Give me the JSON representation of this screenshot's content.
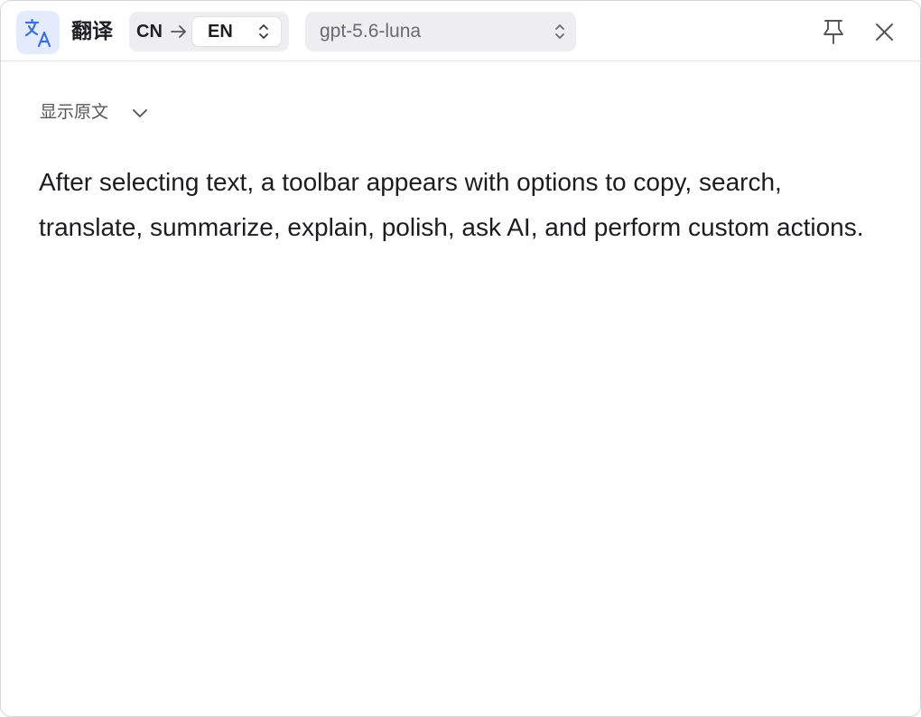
{
  "header": {
    "app_icon": "translate-icon",
    "title": "翻译",
    "source_language": "CN",
    "arrow_icon": "arrow-right-icon",
    "target_language": "EN",
    "target_selector_icon": "chevron-up-down-icon",
    "model": "gpt-5.6-luna",
    "model_selector_icon": "chevron-up-down-icon",
    "pin_icon": "pin-icon",
    "close_icon": "close-icon"
  },
  "content": {
    "show_original_label": "显示原文",
    "show_original_icon": "chevron-down-icon",
    "translation": "After selecting text, a toolbar appears with options to copy, search, translate, summarize, explain, polish, ask AI, and perform custom actions."
  },
  "colors": {
    "accent": "#3d6fe0",
    "icon_background": "#e4ebfd",
    "control_background": "#eeeef1",
    "text_primary": "#1d1d20",
    "text_secondary": "#55555b"
  }
}
